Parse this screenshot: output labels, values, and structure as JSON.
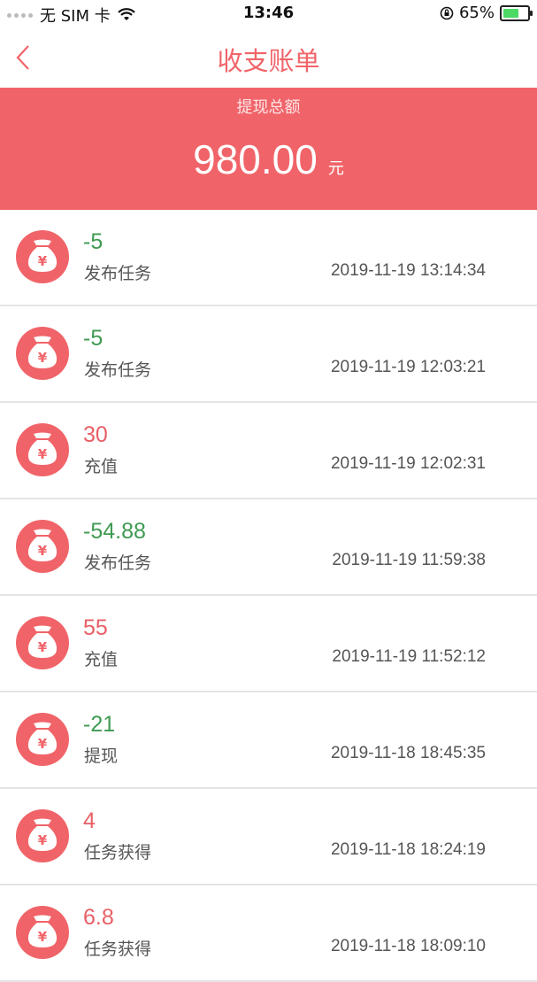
{
  "status_bar": {
    "carrier": "无 SIM 卡",
    "time": "13:46",
    "battery_percent": "65%",
    "battery_level": 0.65
  },
  "nav": {
    "title": "收支账单",
    "back_icon": "chevron-left-icon"
  },
  "summary": {
    "label": "提现总额",
    "amount": "980.00",
    "unit": "元"
  },
  "colors": {
    "accent": "#f06469",
    "negative": "#3f9a52",
    "positive": "#e85f66"
  },
  "records": [
    {
      "amount": "-5",
      "type": "发布任务",
      "time": "2019-11-19 13:14:34",
      "sign": "neg"
    },
    {
      "amount": "-5",
      "type": "发布任务",
      "time": "2019-11-19 12:03:21",
      "sign": "neg"
    },
    {
      "amount": "30",
      "type": "充值",
      "time": "2019-11-19 12:02:31",
      "sign": "pos"
    },
    {
      "amount": "-54.88",
      "type": "发布任务",
      "time": "2019-11-19 11:59:38",
      "sign": "neg"
    },
    {
      "amount": "55",
      "type": "充值",
      "time": "2019-11-19 11:52:12",
      "sign": "pos"
    },
    {
      "amount": "-21",
      "type": "提现",
      "time": "2019-11-18 18:45:35",
      "sign": "neg"
    },
    {
      "amount": "4",
      "type": "任务获得",
      "time": "2019-11-18 18:24:19",
      "sign": "pos"
    },
    {
      "amount": "6.8",
      "type": "任务获得",
      "time": "2019-11-18 18:09:10",
      "sign": "pos"
    }
  ]
}
